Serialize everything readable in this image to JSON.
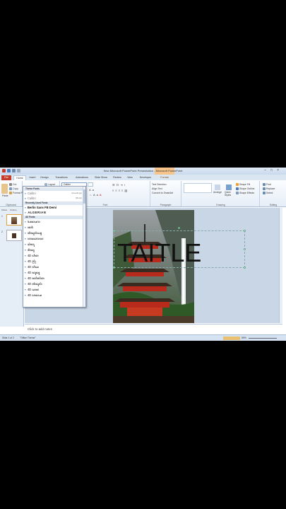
{
  "window": {
    "title": "New Microsoft PowerPoint Presentation - Microsoft PowerPoint",
    "contextual_tab_group": "Drawing Tools",
    "controls": [
      "–",
      "□",
      "×"
    ]
  },
  "tabs": [
    "File",
    "Home",
    "Insert",
    "Design",
    "Transitions",
    "Animations",
    "Slide Show",
    "Review",
    "View",
    "Developer",
    "Format"
  ],
  "ribbon": {
    "clipboard": {
      "paste": "Paste",
      "cut": "Cut",
      "copy": "Copy",
      "format_painter": "Format Painter",
      "label": "Clipboard"
    },
    "slides": {
      "layout": "Layout",
      "reset": "Reset",
      "label": "Slides"
    },
    "font": {
      "current_font": "Calibri",
      "current_size": "",
      "label": "Font"
    },
    "paragraph": {
      "text_direction": "Text Direction",
      "align_text": "Align Text",
      "smartart": "Convert to SmartArt",
      "label": "Paragraph"
    },
    "drawing": {
      "arrange": "Arrange",
      "quick_styles": "Quick Styles",
      "shape_fill": "Shape Fill",
      "shape_outline": "Shape Outline",
      "shape_effects": "Shape Effects",
      "label": "Drawing"
    },
    "editing": {
      "find": "Find",
      "replace": "Replace",
      "select": "Select",
      "label": "Editing"
    }
  },
  "left_pane": {
    "tabs": [
      "Slides",
      "Outline"
    ],
    "slides": [
      "1",
      "2"
    ]
  },
  "font_dropdown": {
    "theme_header": "Theme Fonts",
    "theme_fonts": [
      {
        "name": "Calibri",
        "hint": "(Headings)"
      },
      {
        "name": "Calibri",
        "hint": "(Body)"
      }
    ],
    "recent_header": "Recently Used Fonts",
    "recent_fonts": [
      "Berlin Sans FB Demi",
      "ALGERIAN"
    ],
    "all_header": "All Fonts",
    "all_fonts": [
      "ꦄꦏ꧀ꦱꦫ",
      "ꦗꦮꦶ",
      "ꦠꦶꦤꦸꦭꦶꦱ꧀",
      "ꦲꦤꦕꦫꦏ",
      "ꦱꦶꦏꦸ",
      "ꦩꦶꦤ꧀",
      "4D ꦲꦶꦩ",
      "4D ꦥꦿꦶ",
      "4D ꦧꦶꦱ",
      "4D ꦏꦸꦤ꧀",
      "4D ꦗꦮꦶꦭꦶꦩ",
      "4D ꦠꦶꦤꦸꦭꦶ",
      "4D ꦱꦏ",
      "4D ꦲꦏ꧀ꦱ"
    ]
  },
  "slide": {
    "title": "TAITLE"
  },
  "notes": {
    "placeholder": "Click to add notes"
  },
  "status": {
    "slide": "Slide 1 of 2",
    "theme": "\"Office Theme\"",
    "zoom": "59%"
  }
}
